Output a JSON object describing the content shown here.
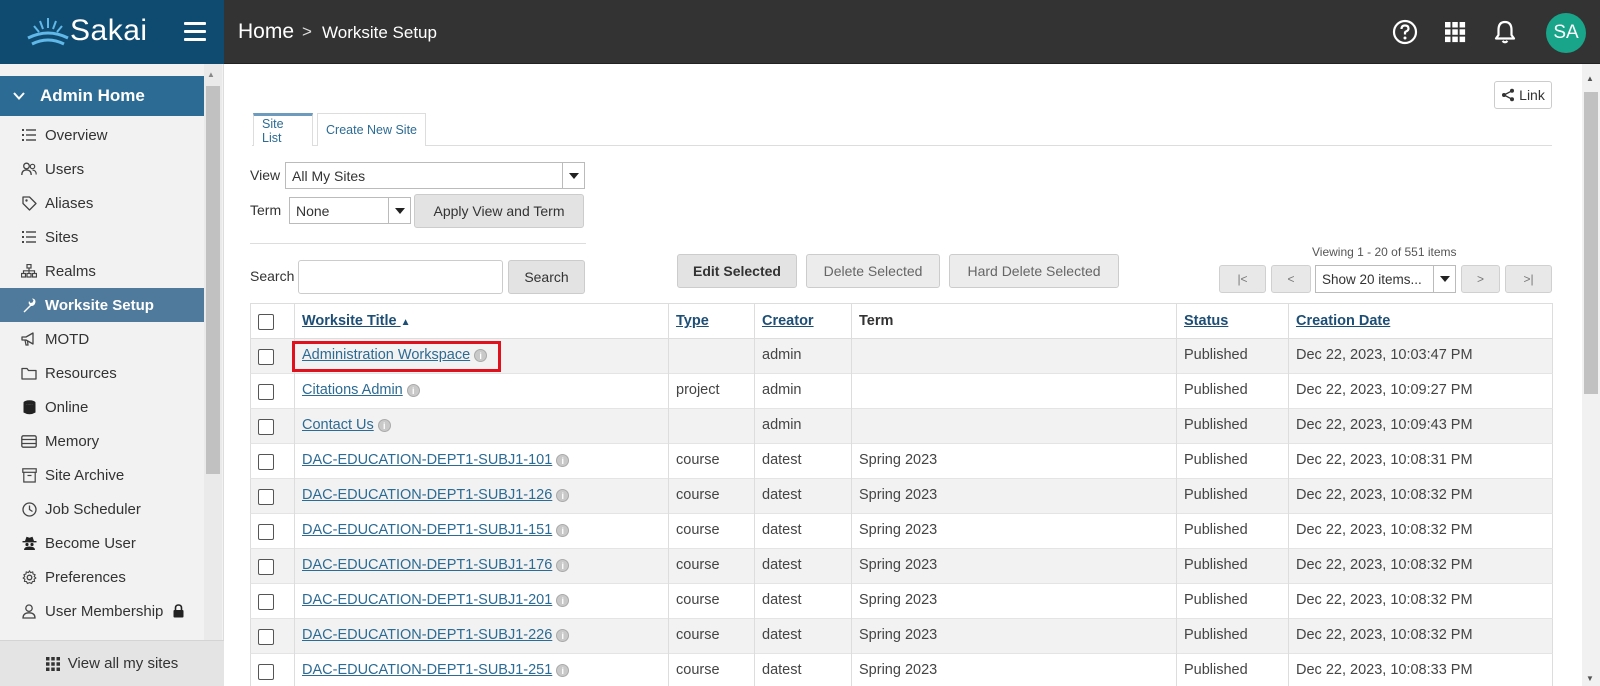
{
  "app": {
    "logo_text": "Sakai"
  },
  "breadcrumb": {
    "home": "Home",
    "separator": ">",
    "current": "Worksite Setup"
  },
  "topbar": {
    "avatar_initials": "SA"
  },
  "sidebar": {
    "section_title": "Admin Home",
    "items": [
      {
        "label": "Overview",
        "icon": "list-icon"
      },
      {
        "label": "Users",
        "icon": "users-icon"
      },
      {
        "label": "Aliases",
        "icon": "tag-icon"
      },
      {
        "label": "Sites",
        "icon": "list-icon"
      },
      {
        "label": "Realms",
        "icon": "sitemap-icon"
      },
      {
        "label": "Worksite Setup",
        "icon": "wrench-icon",
        "active": true
      },
      {
        "label": "MOTD",
        "icon": "megaphone-icon"
      },
      {
        "label": "Resources",
        "icon": "folder-icon"
      },
      {
        "label": "Online",
        "icon": "database-icon"
      },
      {
        "label": "Memory",
        "icon": "memory-icon"
      },
      {
        "label": "Site Archive",
        "icon": "archive-icon"
      },
      {
        "label": "Job Scheduler",
        "icon": "clock-icon"
      },
      {
        "label": "Become User",
        "icon": "user-secret-icon"
      },
      {
        "label": "Preferences",
        "icon": "gear-icon"
      },
      {
        "label": "User Membership",
        "icon": "user-icon"
      }
    ],
    "view_all": "View all my sites"
  },
  "toolbar": {
    "link_label": "Link"
  },
  "tabs": [
    {
      "label": "Site List"
    },
    {
      "label": "Create New Site"
    }
  ],
  "filters": {
    "view_label": "View",
    "view_value": "All My Sites",
    "term_label": "Term",
    "term_value": "None",
    "apply_label": "Apply View and Term",
    "search_label": "Search",
    "search_button": "Search"
  },
  "actions": {
    "edit": "Edit Selected",
    "delete": "Delete Selected",
    "hard_delete": "Hard Delete Selected"
  },
  "pager": {
    "viewing": "Viewing 1 - 20 of 551 items",
    "first": "|<",
    "prev": "<",
    "page_size": "Show 20 items...",
    "next": ">",
    "last": ">|"
  },
  "table": {
    "headers": {
      "title": "Worksite Title",
      "type": "Type",
      "creator": "Creator",
      "term": "Term",
      "status": "Status",
      "created": "Creation Date"
    },
    "rows": [
      {
        "title": "Administration Workspace",
        "type": "",
        "creator": "admin",
        "term": "",
        "status": "Published",
        "created": "Dec 22, 2023, 10:03:47 PM"
      },
      {
        "title": "Citations Admin",
        "type": "project",
        "creator": "admin",
        "term": "",
        "status": "Published",
        "created": "Dec 22, 2023, 10:09:27 PM"
      },
      {
        "title": "Contact Us",
        "type": "",
        "creator": "admin",
        "term": "",
        "status": "Published",
        "created": "Dec 22, 2023, 10:09:43 PM"
      },
      {
        "title": "DAC-EDUCATION-DEPT1-SUBJ1-101",
        "type": "course",
        "creator": "datest",
        "term": "Spring 2023",
        "status": "Published",
        "created": "Dec 22, 2023, 10:08:31 PM"
      },
      {
        "title": "DAC-EDUCATION-DEPT1-SUBJ1-126",
        "type": "course",
        "creator": "datest",
        "term": "Spring 2023",
        "status": "Published",
        "created": "Dec 22, 2023, 10:08:32 PM"
      },
      {
        "title": "DAC-EDUCATION-DEPT1-SUBJ1-151",
        "type": "course",
        "creator": "datest",
        "term": "Spring 2023",
        "status": "Published",
        "created": "Dec 22, 2023, 10:08:32 PM"
      },
      {
        "title": "DAC-EDUCATION-DEPT1-SUBJ1-176",
        "type": "course",
        "creator": "datest",
        "term": "Spring 2023",
        "status": "Published",
        "created": "Dec 22, 2023, 10:08:32 PM"
      },
      {
        "title": "DAC-EDUCATION-DEPT1-SUBJ1-201",
        "type": "course",
        "creator": "datest",
        "term": "Spring 2023",
        "status": "Published",
        "created": "Dec 22, 2023, 10:08:32 PM"
      },
      {
        "title": "DAC-EDUCATION-DEPT1-SUBJ1-226",
        "type": "course",
        "creator": "datest",
        "term": "Spring 2023",
        "status": "Published",
        "created": "Dec 22, 2023, 10:08:32 PM"
      },
      {
        "title": "DAC-EDUCATION-DEPT1-SUBJ1-251",
        "type": "course",
        "creator": "datest",
        "term": "Spring 2023",
        "status": "Published",
        "created": "Dec 22, 2023, 10:08:33 PM"
      }
    ]
  },
  "colors": {
    "topbar": "#333333",
    "brand": "#0f4b70",
    "active_nav": "#4f7a9b",
    "link": "#2c6b94",
    "highlight": "#e0101c",
    "avatar": "#18a58a"
  }
}
